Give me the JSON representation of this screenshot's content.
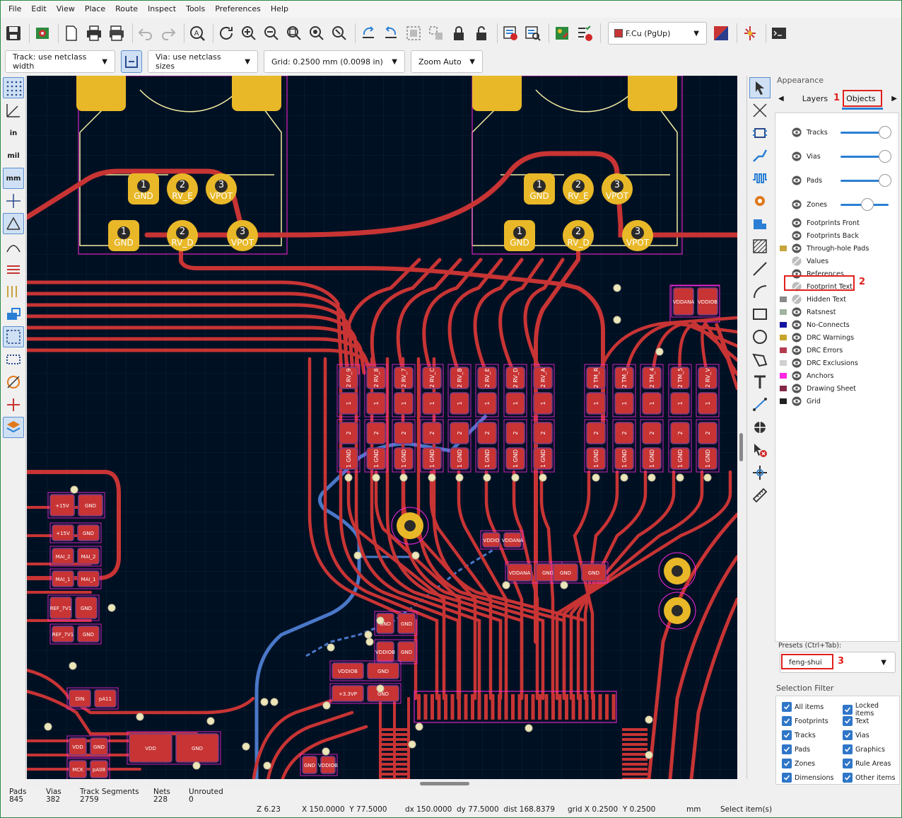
{
  "menu": [
    "File",
    "Edit",
    "View",
    "Place",
    "Route",
    "Inspect",
    "Tools",
    "Preferences",
    "Help"
  ],
  "layer_select": {
    "label": "F.Cu (PgUp)",
    "color": "#c83434"
  },
  "toolbar2": {
    "track_width": "Track: use netclass width",
    "via_size": "Via: use netclass sizes",
    "grid": "Grid: 0.2500 mm (0.0098 in)",
    "zoom": "Zoom Auto"
  },
  "left_toolbar": {
    "in_label": "in",
    "mil_label": "mil",
    "mm_label": "mm"
  },
  "appearance": {
    "title": "Appearance",
    "tab_layers": "Layers",
    "tab_objects": "Objects",
    "callout_1": "1",
    "callout_2": "2",
    "callout_3": "3",
    "objects": [
      {
        "label": "Tracks",
        "swatch": "",
        "visible": true,
        "opacity": 1.0
      },
      {
        "label": "Vias",
        "swatch": "",
        "visible": true,
        "opacity": 1.0
      },
      {
        "label": "Pads",
        "swatch": "",
        "visible": true,
        "opacity": 1.0
      },
      {
        "label": "Zones",
        "swatch": "",
        "visible": true,
        "opacity": 0.6
      },
      {
        "label": "Footprints Front",
        "swatch": "",
        "visible": true
      },
      {
        "label": "Footprints Back",
        "swatch": "",
        "visible": true
      },
      {
        "label": "Through-hole Pads",
        "swatch": "#c8a43c",
        "visible": true
      },
      {
        "label": "Values",
        "swatch": "",
        "visible": false
      },
      {
        "label": "References",
        "swatch": "",
        "visible": true
      },
      {
        "label": "Footprint Text",
        "swatch": "",
        "visible": false
      },
      {
        "label": "Hidden Text",
        "swatch": "#8a8a8a",
        "visible": false
      },
      {
        "label": "Ratsnest",
        "swatch": "#a0b4a0",
        "visible": true
      },
      {
        "label": "No-Connects",
        "swatch": "#1414a0",
        "visible": true
      },
      {
        "label": "DRC Warnings",
        "swatch": "#c8a42c",
        "visible": true
      },
      {
        "label": "DRC Errors",
        "swatch": "#b43c50",
        "visible": true
      },
      {
        "label": "DRC Exclusions",
        "swatch": "#d0d0d0",
        "visible": true
      },
      {
        "label": "Anchors",
        "swatch": "#ff26e2",
        "visible": true
      },
      {
        "label": "Drawing Sheet",
        "swatch": "#842848",
        "visible": true
      },
      {
        "label": "Grid",
        "swatch": "#222222",
        "visible": true
      }
    ],
    "presets_label": "Presets (Ctrl+Tab):",
    "preset_value": "feng-shui"
  },
  "selection_filter": {
    "title": "Selection Filter",
    "left": [
      "All items",
      "Footprints",
      "Tracks",
      "Pads",
      "Zones",
      "Dimensions"
    ],
    "right": [
      "Locked items",
      "Text",
      "Vias",
      "Graphics",
      "Rule Areas",
      "Other items"
    ]
  },
  "status": {
    "pads_label": "Pads",
    "pads": "845",
    "vias_label": "Vias",
    "vias": "382",
    "tracks_label": "Track Segments",
    "tracks": "2759",
    "nets_label": "Nets",
    "nets": "228",
    "unrouted_label": "Unrouted",
    "unrouted": "0",
    "zoom": "Z 6.23",
    "xy": "X 150.0000  Y 77.5000",
    "dxy": "dx 150.0000  dy 77.5000  dist 168.8379",
    "grid": "grid X 0.2500  Y 0.2500",
    "units": "mm",
    "mode": "Select item(s)"
  },
  "pcb": {
    "pot_pins": [
      {
        "num": "1",
        "net": "GND"
      },
      {
        "num": "2",
        "net": "RV_E"
      },
      {
        "num": "3",
        "net": "VPOT"
      },
      {
        "num": "1",
        "net": "GND"
      },
      {
        "num": "2",
        "net": "RV_D"
      },
      {
        "num": "3",
        "net": "VPOT"
      }
    ],
    "resistor_nets": [
      "RV_9",
      "RV_8",
      "RV_7",
      "RV_C",
      "RV_B",
      "RV_E",
      "RV_D",
      "RV_A",
      "TM_R",
      "TM_3",
      "TM_4",
      "TM_5",
      "RV_V"
    ],
    "pin_one": "1",
    "pin_two": "2",
    "gnd_label": "GND",
    "labels": {
      "p15v": "+15V",
      "gnd": "GND",
      "mai2": "MAI_2",
      "mai1": "MAI_1",
      "vddio": "VDDIO",
      "vddana": "VDDANA",
      "vddiob": "VDDIOB",
      "p33vp": "+3.3VP",
      "din": "DIN",
      "pa11": "pA11",
      "vdd": "VDD",
      "mck": "MCK",
      "pa08": "pA08",
      "ref": "REF_7V1"
    },
    "colors": {
      "bg": "#001023",
      "copper": "#c83434",
      "pad": "#e8b828",
      "back": "#4a78c8",
      "silk": "#f2eda1",
      "courtyard": "#ff26e2"
    }
  }
}
